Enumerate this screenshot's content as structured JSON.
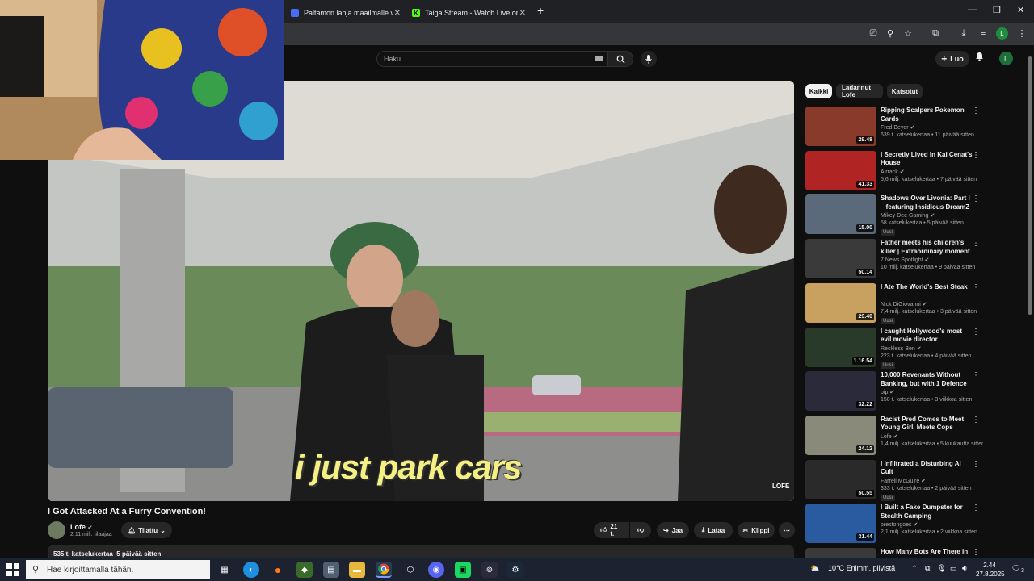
{
  "browser": {
    "tabs": [
      {
        "title": "Paltamon lahja maailmalle vol.",
        "favicon_color": "#4a6cf7"
      },
      {
        "title": "Taiga Stream - Watch Live on K",
        "favicon_color": "#53fc18"
      }
    ],
    "profile_letter": "L",
    "icons": [
      "cast-icon",
      "zoom-icon",
      "star-icon",
      "extensions-icon",
      "download-icon",
      "media-icon",
      "menu-icon"
    ]
  },
  "masthead": {
    "search_placeholder": "Haku",
    "create_label": "Luo",
    "avatar_letter": "L"
  },
  "video": {
    "caption": "i just park cars",
    "watermark": "LOFE",
    "title": "I Got Attacked At a Furry Convention!",
    "channel": "Lofe",
    "subscribers": "2,11 milj. tilaajaa",
    "subscribe_label": "Tilattu",
    "likes": "21 t.",
    "share_label": "Jaa",
    "download_label": "Lataa",
    "clip_label": "Klippi",
    "views": "535 t. katselukertaa",
    "age": "5 päivää sitten"
  },
  "chips": [
    {
      "label": "Kaikki",
      "active": true
    },
    {
      "label": "Ladannut Lofe",
      "active": false
    },
    {
      "label": "Katsotut",
      "active": false
    }
  ],
  "recommendations": [
    {
      "title": "Ripping Scalpers Pokemon Cards",
      "channel": "Fred Beyer",
      "meta": "639 t. katselukertaa • 11 päivää sitten",
      "duration": "29.48",
      "badge": "",
      "color": "#8a3a2a"
    },
    {
      "title": "I Secretly Lived In Kai Cenat's House",
      "channel": "Airrack",
      "meta": "5,6 milj. katselukertaa • 7 päivää sitten",
      "duration": "41.33",
      "badge": "",
      "color": "#b02424"
    },
    {
      "title": "Shadows Over Livonia: Part I – featuring Insidious DreamZ",
      "channel": "Mikey Dee Gaming",
      "meta": "58 katselukertaa • 5 päivää sitten",
      "duration": "15.00",
      "badge": "Uusi",
      "color": "#5a6a7a"
    },
    {
      "title": "Father meets his children's killer | Extraordinary moment inside ...",
      "channel": "7 News Spotlight",
      "meta": "10 milj. katselukertaa • 9 päivää sitten",
      "duration": "50.14",
      "badge": "",
      "color": "#3a3a3a"
    },
    {
      "title": "I Ate The World's Best Steak",
      "channel": "Nick DiGiovanni",
      "meta": "7,4 milj. katselukertaa • 3 päivää sitten",
      "duration": "29.40",
      "badge": "Uusi",
      "color": "#c8a060"
    },
    {
      "title": "I caught Hollywood's most evil movie director",
      "channel": "Reckless Ben",
      "meta": "223 t. katselukertaa • 4 päivää sitten",
      "duration": "1.16.54",
      "badge": "Uusi",
      "color": "#2a3a2a"
    },
    {
      "title": "10,000 Revenants Without Banking, but with 1 Defence",
      "channel": "pip",
      "meta": "150 t. katselukertaa • 3 viikkoa sitten",
      "duration": "32.22",
      "badge": "",
      "color": "#2a2a3a"
    },
    {
      "title": "Racist Pred Comes to Meet Young Girl, Meets Cops Instead!",
      "channel": "Lofe",
      "meta": "1,4 milj. katselukertaa • 5 kuukautta sitten",
      "duration": "24.12",
      "badge": "",
      "color": "#8a8a7a"
    },
    {
      "title": "I Infiltrated a Disturbing AI Cult",
      "channel": "Farrell McGuire",
      "meta": "333 t. katselukertaa • 2 päivää sitten",
      "duration": "50.55",
      "badge": "Uusi",
      "color": "#2a2a2a"
    },
    {
      "title": "I Built a Fake Dumpster for Stealth Camping",
      "channel": "prestongoes",
      "meta": "2,1 milj. katselukertaa • 2 viikkoa sitten",
      "duration": "31.44",
      "badge": "",
      "color": "#2a5aa0"
    },
    {
      "title": "How Many Bots Are There in",
      "channel": "",
      "meta": "",
      "duration": "",
      "badge": "",
      "color": "#3a3a3a"
    }
  ],
  "taskbar": {
    "search_placeholder": "Hae kirjoittamalla tähän.",
    "weather": "10°C  Enimm. pilvistä",
    "time": "2.44",
    "date": "27.8.2025",
    "notifications": "3"
  }
}
